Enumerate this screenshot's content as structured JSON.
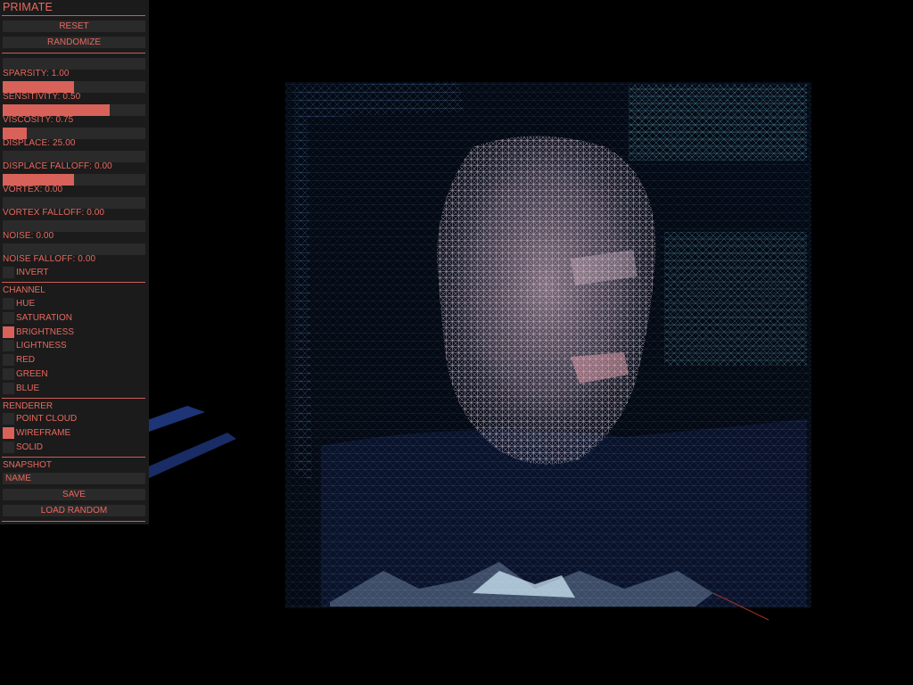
{
  "panel": {
    "title": "PRIMATE",
    "reset_label": "RESET",
    "randomize_label": "RANDOMIZE",
    "sliders": [
      {
        "label": "SPARSITY:  1.00",
        "fraction": 0.0
      },
      {
        "label": "SENSITIVITY:  0.50",
        "fraction": 0.5
      },
      {
        "label": "VISCOSITY:  0.75",
        "fraction": 0.75
      },
      {
        "label": "DISPLACE:  25.00",
        "fraction": 0.17
      },
      {
        "label": "DISPLACE  FALLOFF:  0.00",
        "fraction": 0.0
      },
      {
        "label": "VORTEX:  0.00",
        "fraction": 0.5
      },
      {
        "label": "VORTEX  FALLOFF:  0.00",
        "fraction": 0.0
      },
      {
        "label": "NOISE:  0.00",
        "fraction": 0.0
      },
      {
        "label": "NOISE  FALLOFF:  0.00",
        "fraction": 0.0
      }
    ],
    "invert_label": "INVERT",
    "invert_on": false,
    "channel_heading": "CHANNEL",
    "channels": [
      {
        "label": "HUE",
        "on": false
      },
      {
        "label": "SATURATION",
        "on": false
      },
      {
        "label": "BRIGHTNESS",
        "on": true
      },
      {
        "label": "LIGHTNESS",
        "on": false
      },
      {
        "label": "RED",
        "on": false
      },
      {
        "label": "GREEN",
        "on": false
      },
      {
        "label": "BLUE",
        "on": false
      }
    ],
    "renderer_heading": "RENDERER",
    "renderers": [
      {
        "label": "POINT  CLOUD",
        "on": false
      },
      {
        "label": "WIREFRAME",
        "on": true
      },
      {
        "label": "SOLID",
        "on": false
      }
    ],
    "snapshot_heading": "SNAPSHOT",
    "snapshot_placeholder": "NAME",
    "save_label": "SAVE",
    "load_random_label": "LOAD  RANDOM"
  },
  "colors": {
    "accent": "#e7695f",
    "panel_bg": "#1b1b1b",
    "control_bg": "#2a2a2a",
    "canvas_bg": "#000000"
  }
}
